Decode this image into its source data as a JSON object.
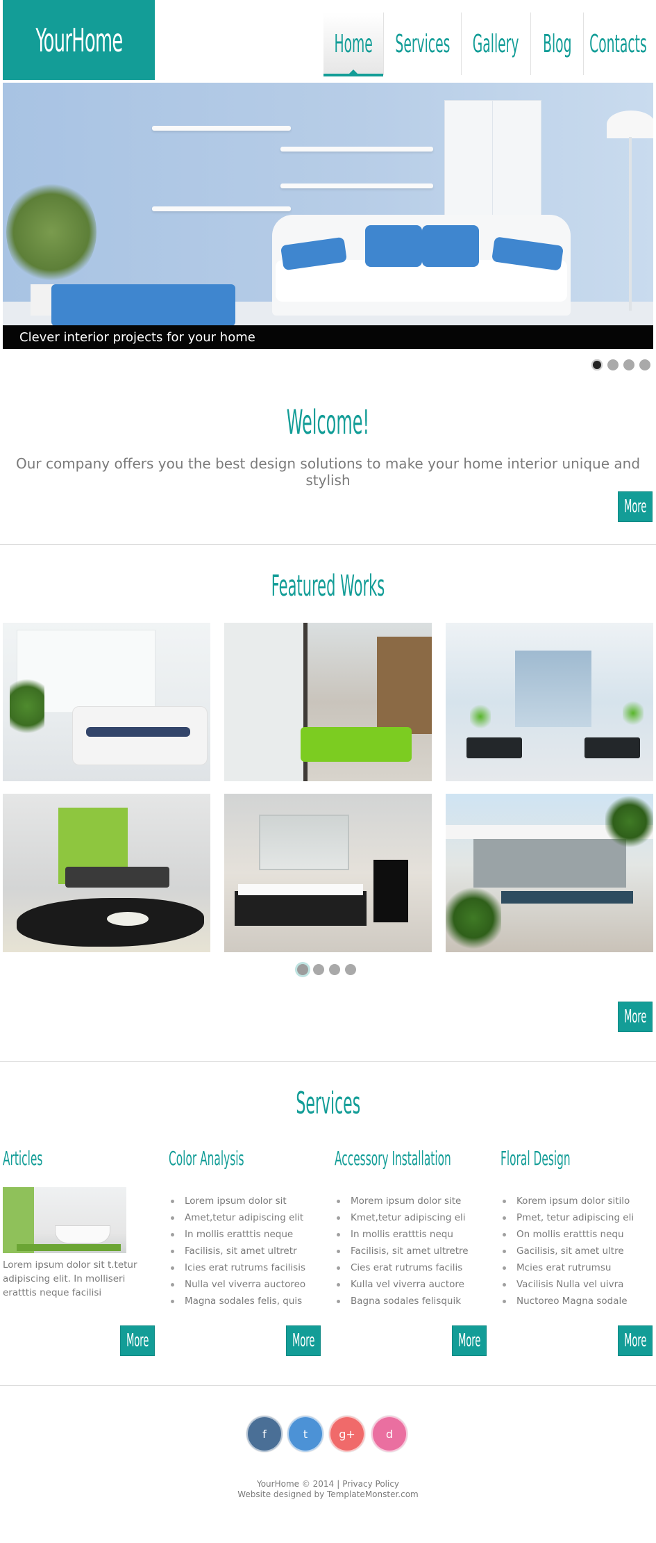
{
  "header": {
    "logo": "YourHome",
    "nav": [
      {
        "label": "Home",
        "active": true
      },
      {
        "label": "Services",
        "active": false
      },
      {
        "label": "Gallery",
        "active": false
      },
      {
        "label": "Blog",
        "active": false
      },
      {
        "label": "Contacts",
        "active": false
      }
    ]
  },
  "hero": {
    "caption": "Clever interior projects for your home",
    "slides": 4,
    "active_slide": 1
  },
  "welcome": {
    "title": "Welcome!",
    "text": "Our company offers you the best design solutions to make your home interior unique and stylish",
    "more_label": "More"
  },
  "featured": {
    "title": "Featured Works",
    "pages": 4,
    "active_page": 1,
    "more_label": "More"
  },
  "services": {
    "title": "Services",
    "columns": [
      {
        "title": "Articles",
        "text": "Lorem ipsum dolor sit t.tetur adipiscing elit. In molliseri eratttis neque facilisi",
        "more_label": "More"
      },
      {
        "title": "Color Analysis",
        "items": [
          "Lorem ipsum dolor sit",
          "Amet,tetur adipiscing elit",
          "In mollis eratttis neque",
          "Facilisis, sit amet ultretr",
          "Icies erat rutrums facilisis",
          "Nulla vel viverra auctoreo",
          "Magna sodales felis, quis"
        ],
        "more_label": "More"
      },
      {
        "title": "Accessory Installation",
        "items": [
          "Morem ipsum dolor site",
          "Kmet,tetur adipiscing eli",
          "In mollis eratttis nequ",
          "Facilisis, sit amet ultretre",
          "Cies erat rutrums facilis",
          "Kulla vel viverra auctore",
          "Bagna sodales felisquik"
        ],
        "more_label": "More"
      },
      {
        "title": "Floral Design",
        "items": [
          "Korem ipsum dolor sitilo",
          "Pmet, tetur adipiscing eli",
          "On mollis eratttis nequ",
          "Gacilisis, sit amet ultre",
          "Mcies erat rutrumsu",
          "Vacilisis Nulla vel uivra",
          "Nuctoreo Magna sodale"
        ],
        "more_label": "More"
      }
    ]
  },
  "footer": {
    "social": [
      {
        "name": "facebook",
        "glyph": "f",
        "color": "#4a6f96"
      },
      {
        "name": "twitter",
        "glyph": "t",
        "color": "#4c92d6"
      },
      {
        "name": "google-plus",
        "glyph": "g+",
        "color": "#f06a6a"
      },
      {
        "name": "dribbble",
        "glyph": "d",
        "color": "#ea6fa0"
      }
    ],
    "copyright": "YourHome © 2014",
    "privacy": "Privacy Policy",
    "credit": "Website designed by TemplateMonster.com"
  },
  "colors": {
    "accent": "#139d97",
    "caption_bg": "#050505"
  }
}
